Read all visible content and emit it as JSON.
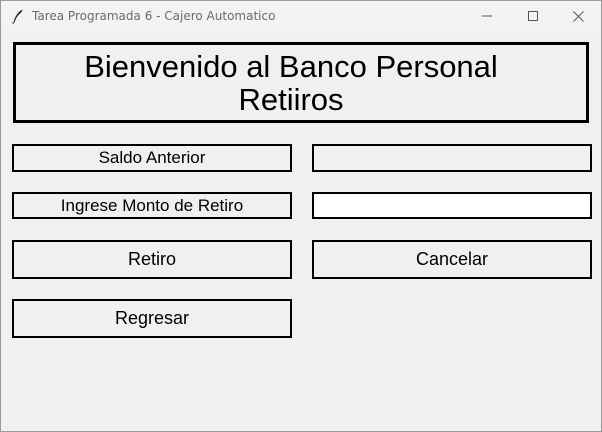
{
  "window": {
    "title": "Tarea Programada 6 - Cajero Automatico",
    "icon": "feather-icon",
    "controls": [
      "minimize-icon",
      "maximize-icon",
      "close-icon"
    ]
  },
  "header": {
    "line1": "Bienvenido al Banco Personal",
    "line2": "Retiiros"
  },
  "form": {
    "previous_balance_label": "Saldo Anterior",
    "previous_balance_value": "",
    "amount_label": "Ingrese Monto de Retiro",
    "amount_value": ""
  },
  "buttons": {
    "withdraw": "Retiro",
    "cancel": "Cancelar",
    "back": "Regresar"
  }
}
